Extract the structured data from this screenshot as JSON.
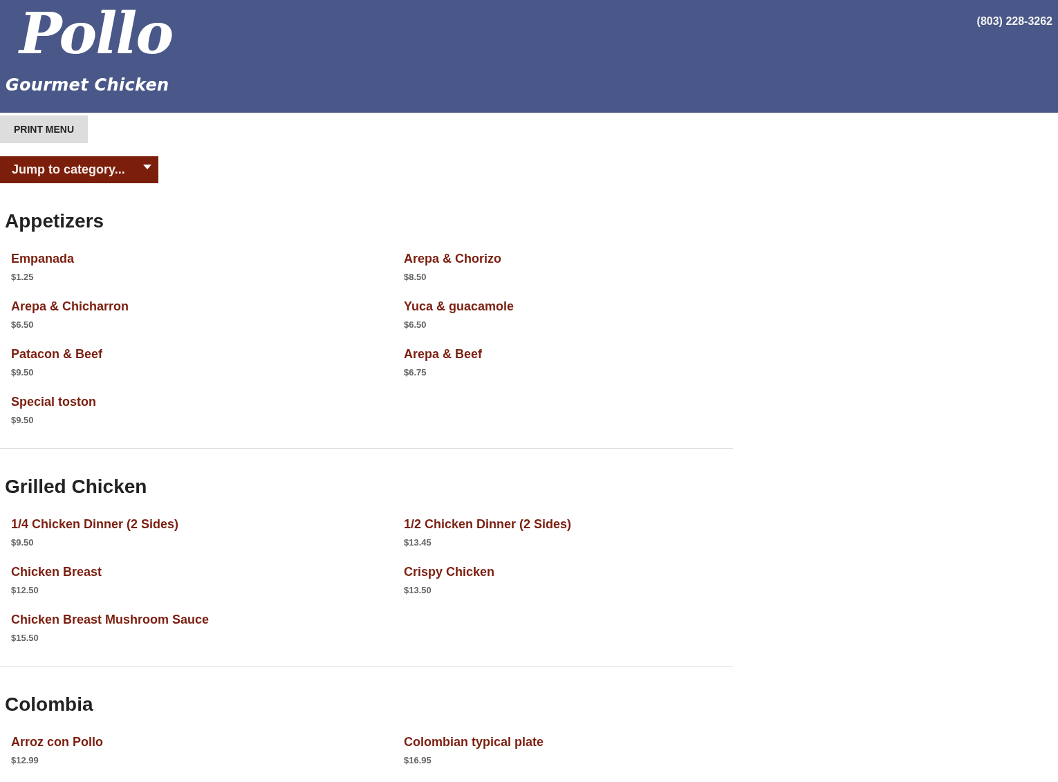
{
  "header": {
    "logo": {
      "wordmark": "Pollo",
      "tagline": "Gourmet Chicken"
    },
    "phone": "(803) 228-3262"
  },
  "print_button": {
    "label": "PRINT MENU"
  },
  "category_select": {
    "value": "Jump to category..."
  },
  "sections": [
    {
      "title": "Appetizers",
      "items": [
        {
          "name": "Empanada",
          "price": "$1.25"
        },
        {
          "name": "Arepa & Chorizo",
          "price": "$8.50"
        },
        {
          "name": "Arepa & Chicharron",
          "price": "$6.50"
        },
        {
          "name": "Yuca & guacamole",
          "price": "$6.50"
        },
        {
          "name": "Patacon & Beef",
          "price": "$9.50"
        },
        {
          "name": "Arepa & Beef",
          "price": "$6.75"
        },
        {
          "name": "Special toston",
          "price": "$9.50"
        }
      ]
    },
    {
      "title": "Grilled Chicken",
      "items": [
        {
          "name": "1/4 Chicken Dinner (2 Sides)",
          "price": "$9.50"
        },
        {
          "name": "1/2 Chicken Dinner (2 Sides)",
          "price": "$13.45"
        },
        {
          "name": "Chicken Breast",
          "price": "$12.50"
        },
        {
          "name": "Crispy Chicken",
          "price": "$13.50"
        },
        {
          "name": "Chicken Breast Mushroom Sauce",
          "price": "$15.50"
        }
      ]
    },
    {
      "title": "Colombia",
      "items": [
        {
          "name": "Arroz con Pollo",
          "price": "$12.99"
        },
        {
          "name": "Colombian typical plate",
          "price": "$16.95"
        }
      ]
    }
  ]
}
